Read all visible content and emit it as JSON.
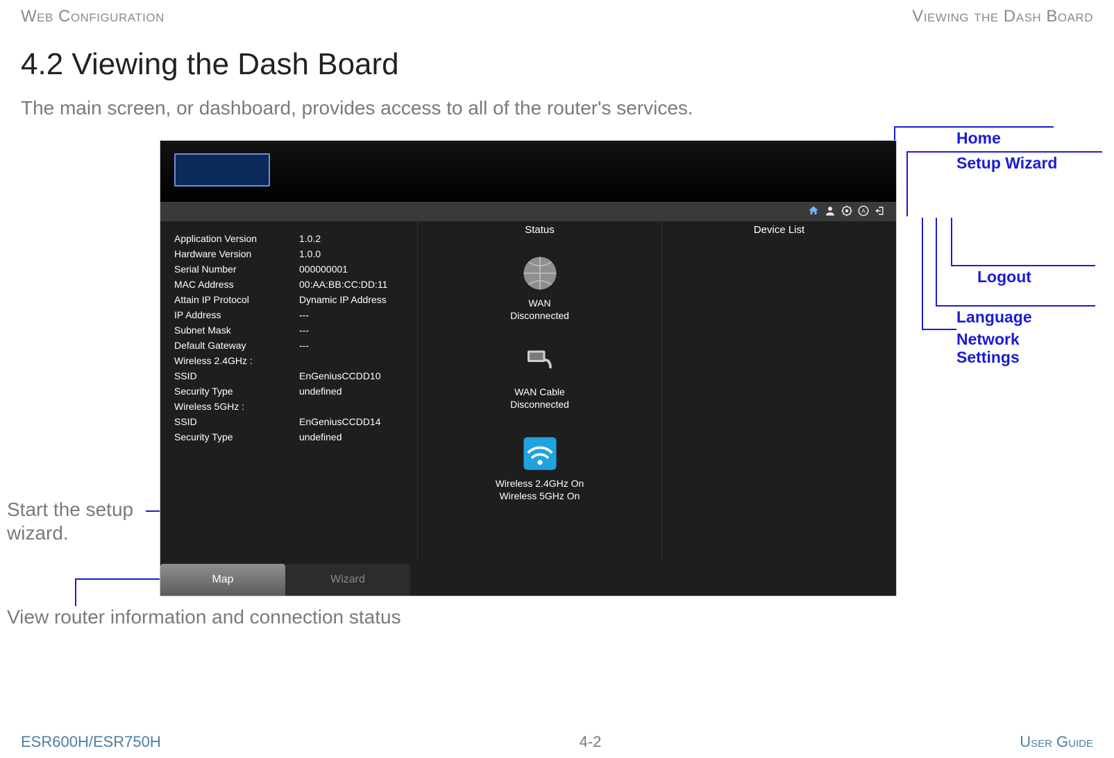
{
  "header": {
    "left": "Web Configuration",
    "right": "Viewing the Dash Board"
  },
  "title": "4.2 Viewing the Dash Board",
  "intro": "The main screen, or dashboard, provides access to all of the router's services.",
  "annotations": {
    "home": "Home",
    "setup_wizard": "Setup Wizard",
    "logout": "Logout",
    "language": "Language",
    "network_settings": "Network\nSettings",
    "start_wizard": "Start the setup wizard.",
    "view_router": "View router information and connection status"
  },
  "screenshot": {
    "columns": {
      "status": "Status",
      "device_list": "Device List"
    },
    "info": [
      {
        "k": "Application Version",
        "v": "1.0.2"
      },
      {
        "k": "Hardware Version",
        "v": "1.0.0"
      },
      {
        "k": "Serial Number",
        "v": "000000001"
      },
      {
        "k": "MAC Address",
        "v": "00:AA:BB:CC:DD:11"
      },
      {
        "k": "Attain IP Protocol",
        "v": "Dynamic IP Address"
      },
      {
        "k": "IP Address",
        "v": "---"
      },
      {
        "k": "Subnet Mask",
        "v": "---"
      },
      {
        "k": "Default Gateway",
        "v": "---"
      }
    ],
    "wireless24_label": "Wireless 2.4GHz :",
    "wireless24": [
      {
        "k": "SSID",
        "v": "EnGeniusCCDD10"
      },
      {
        "k": "Security Type",
        "v": "undefined"
      }
    ],
    "wireless5_label": "Wireless 5GHz :",
    "wireless5": [
      {
        "k": "SSID",
        "v": "EnGeniusCCDD14"
      },
      {
        "k": "Security Type",
        "v": "undefined"
      }
    ],
    "status_items": {
      "wan": {
        "line1": "WAN",
        "line2": "Disconnected"
      },
      "cable": {
        "line1": "WAN Cable",
        "line2": "Disconnected"
      },
      "wifi": {
        "line1": "Wireless 2.4GHz On",
        "line2": "Wireless 5GHz On"
      }
    },
    "tabs": {
      "map": "Map",
      "wizard": "Wizard"
    },
    "icons": {
      "home": "home-icon",
      "wizard": "person-wizard-icon",
      "network": "network-gear-icon",
      "language": "globe-a-icon",
      "logout": "logout-icon"
    }
  },
  "footer": {
    "left": "ESR600H/ESR750H",
    "center": "4-2",
    "right": "User Guide"
  }
}
